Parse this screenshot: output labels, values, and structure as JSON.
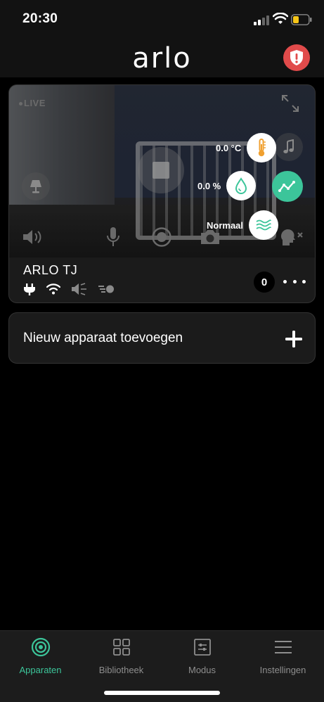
{
  "status_bar": {
    "time": "20:30"
  },
  "header": {
    "logo_text": "arlo"
  },
  "device": {
    "live_label": "LIVE",
    "name": "ARLO TJ",
    "temperature": "0.0 °C",
    "humidity": "0.0 %",
    "air_quality": "Normaal",
    "count": "0"
  },
  "add_device": {
    "label": "Nieuw apparaat toevoegen"
  },
  "tabs": [
    {
      "label": "Apparaten",
      "icon": "devices-icon",
      "active": true
    },
    {
      "label": "Bibliotheek",
      "icon": "library-icon",
      "active": false
    },
    {
      "label": "Modus",
      "icon": "mode-icon",
      "active": false
    },
    {
      "label": "Instellingen",
      "icon": "settings-icon",
      "active": false
    }
  ],
  "colors": {
    "accent": "#3cc59a",
    "alert": "#e14b4b",
    "battery": "#f5c518",
    "thermo": "#f0a030"
  }
}
